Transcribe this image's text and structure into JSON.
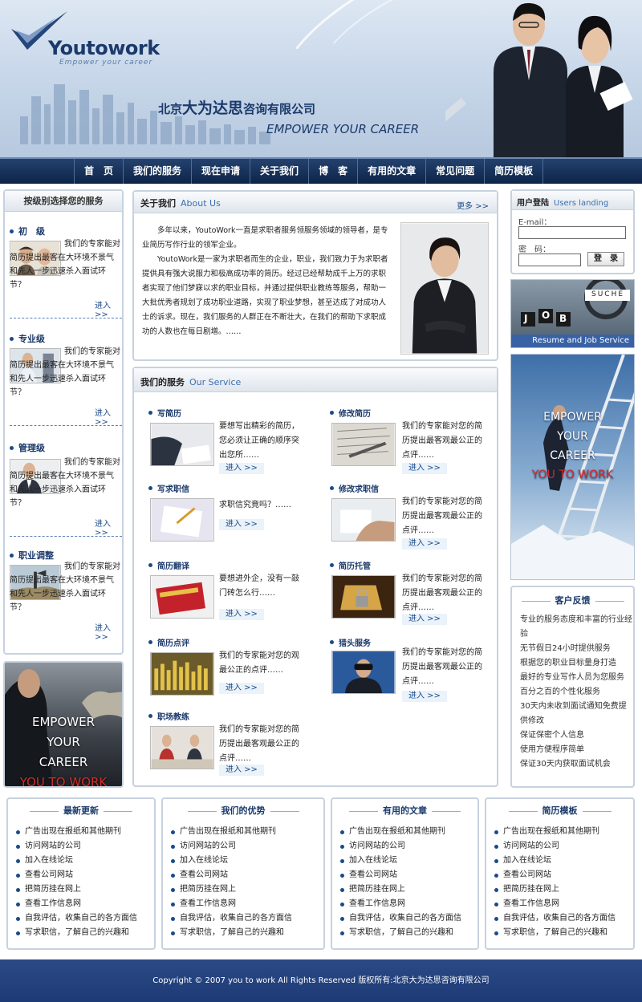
{
  "brand": {
    "logo_text": "Youtowork",
    "tagline": "Empower your career",
    "company_prefix": "北京",
    "company_bold": "大为达思",
    "company_suffix": "咨询有限公司",
    "slogan": "EMPOWER YOUR CAREER"
  },
  "nav": [
    "首　页",
    "我们的服务",
    "现在申请",
    "关于我们",
    "博　客",
    "有用的文章",
    "常见问题",
    "简历模板"
  ],
  "left": {
    "title": "按级别选择您的服务",
    "more": "进入>>",
    "body": "我们的专家能对简历提出最客在大环境不景气和先人一步迅速杀入面试环节？",
    "items": [
      {
        "label": "初　级"
      },
      {
        "label": "专业级"
      },
      {
        "label": "管理级"
      },
      {
        "label": "职业调整"
      }
    ]
  },
  "left_banner": {
    "l1": "EMPOWER",
    "l2": "YOUR",
    "l3": "CAREER",
    "l4": "YOU TO WORK"
  },
  "about": {
    "title": "关于我们",
    "title_en": "About Us",
    "more": "更多 >>",
    "p1": "　　多年以来，YoutoWork一直是求职者服务领服务领域的领导者，是专业简历写作行业的领军企业。",
    "p2": "　　YoutoWork是一家为求职者而生的企业，职业，我们致力于为求职者提供具有强大说服力和极高成功率的简历。经过已经帮助成千上万的求职者实现了他们梦寐以求的职业目标，并通过提供职业教练等服务，帮助一大批优秀者规划了成功职业道路，实现了职业梦想，甚至达成了对成功人士的诉求。现在，我们服务的人群正在不断壮大，在我们的帮助下求职成功的人数也在每日剧增。……"
  },
  "services": {
    "title": "我们的服务",
    "title_en": "Our Service",
    "enter": "进入 >>",
    "items": [
      {
        "title": "写简历",
        "desc": "要想写出精彩的简历，您必须让正确的顺序突出您所……"
      },
      {
        "title": "修改简历",
        "desc": "我们的专家能对您的简历提出最客观最公正的点评……"
      },
      {
        "title": "写求职信",
        "desc": "求职信究竟吗？……"
      },
      {
        "title": "修改求职信",
        "desc": "我们的专家能对您的简历提出最客观最公正的点评……"
      },
      {
        "title": "简历翻译",
        "desc": "要想进外企，没有一敲门砖怎么行……"
      },
      {
        "title": "简历托管",
        "desc": "我们的专家能对您的简历提出最客观最公正的点评……"
      },
      {
        "title": "简历点评",
        "desc": "我们的专家能对您的观最公正的点评……"
      },
      {
        "title": "猎头服务",
        "desc": "我们的专家能对您的简历提出最客观最公正的点评……"
      },
      {
        "title": "职场教练",
        "desc": "我们的专家能对您的简历提出最客观最公正的点评……"
      }
    ]
  },
  "login": {
    "title": "用户登陆",
    "title_en": "Users landing",
    "email_label": "E-mail：",
    "pwd_label": "密　码：",
    "button": "登　录"
  },
  "job_banner": {
    "caption": "Resume and Job Service",
    "tiles": [
      "J",
      "O",
      "B"
    ],
    "sign": "SUCHE"
  },
  "right_banner": {
    "l1": "EMPOWER",
    "l2": "YOUR",
    "l3": "CAREER",
    "l4": "YOU TO WORK"
  },
  "feedback": {
    "title": "客户反馈",
    "lines": [
      "专业的服务态度和丰富的行业经验",
      "无节假日24小时提供服务",
      "根据您的职业目标量身打造",
      "最好的专业写作人员为您服务",
      "百分之百的个性化服务",
      "30天内未收到面试通知免费提供修改",
      "保证保密个人信息",
      "使用方便程序简单",
      "保证30天内获取面试机会"
    ]
  },
  "bottom": [
    {
      "title": "最新更新",
      "items": [
        "广告出现在报纸和其他期刊",
        "访问网站的公司",
        "加入在线论坛",
        "查看公司网站",
        "把简历挂在网上",
        "查看工作信息网",
        "自我评估，收集自己的各方面信",
        "写求职信，了解自己的兴趣和"
      ]
    },
    {
      "title": "我们的优势",
      "items": [
        "广告出现在报纸和其他期刊",
        "访问网站的公司",
        "加入在线论坛",
        "查看公司网站",
        "把简历挂在网上",
        "查看工作信息网",
        "自我评估，收集自己的各方面信",
        "写求职信，了解自己的兴趣和"
      ]
    },
    {
      "title": "有用的文章",
      "items": [
        "广告出现在报纸和其他期刊",
        "访问网站的公司",
        "加入在线论坛",
        "查看公司网站",
        "把简历挂在网上",
        "查看工作信息网",
        "自我评估，收集自己的各方面信",
        "写求职信，了解自己的兴趣和"
      ]
    },
    {
      "title": "简历模板",
      "items": [
        "广告出现在报纸和其他期刊",
        "访问网站的公司",
        "加入在线论坛",
        "查看公司网站",
        "把简历挂在网上",
        "查看工作信息网",
        "自我评估，收集自己的各方面信",
        "写求职信，了解自己的兴趣和"
      ]
    }
  ],
  "footer": {
    "text": "Copyright © 2007 you to work All Rights Reserved 版权所有:北京大为达思咨询有限公司"
  }
}
